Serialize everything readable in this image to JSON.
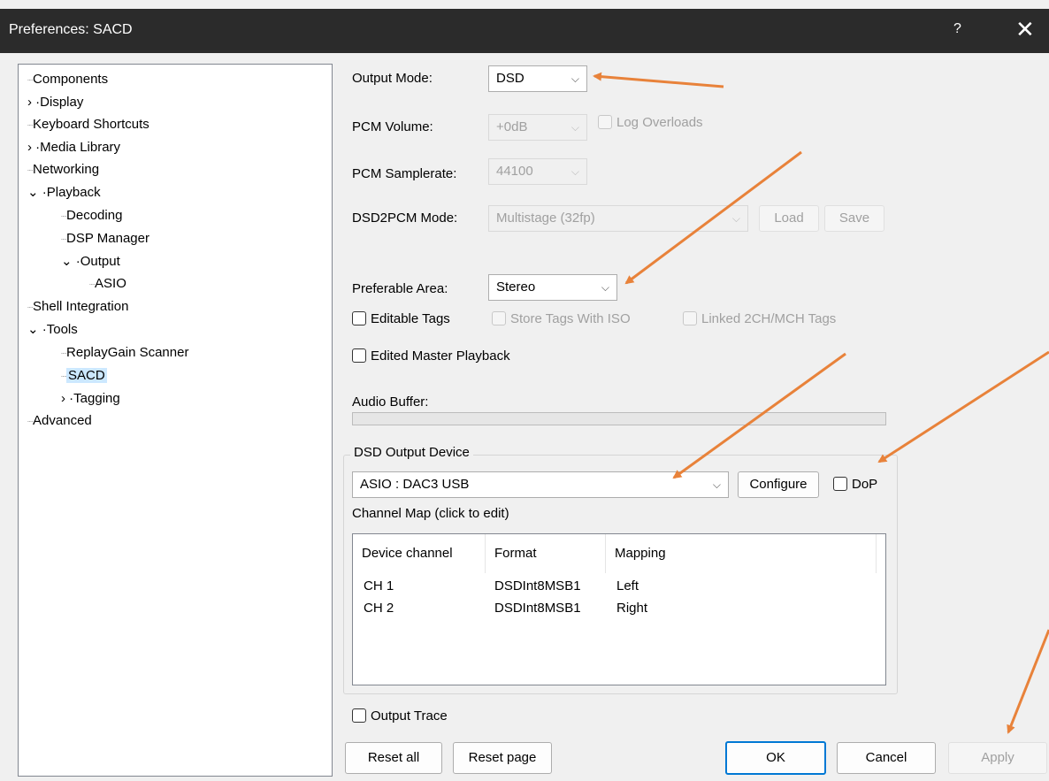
{
  "window": {
    "title": "Preferences: SACD",
    "help_glyph": "?",
    "close_glyph": "✕"
  },
  "tree": {
    "items": [
      {
        "label": "Components",
        "expander": ""
      },
      {
        "label": "Display",
        "expander": "›"
      },
      {
        "label": "Keyboard Shortcuts",
        "expander": ""
      },
      {
        "label": "Media Library",
        "expander": "›"
      },
      {
        "label": "Networking",
        "expander": ""
      },
      {
        "label": "Playback",
        "expander": "⌄"
      },
      {
        "label": "Decoding",
        "expander": ""
      },
      {
        "label": "DSP Manager",
        "expander": ""
      },
      {
        "label": "Output",
        "expander": "⌄"
      },
      {
        "label": "ASIO",
        "expander": ""
      },
      {
        "label": "Shell Integration",
        "expander": ""
      },
      {
        "label": "Tools",
        "expander": "⌄"
      },
      {
        "label": "ReplayGain Scanner",
        "expander": ""
      },
      {
        "label": "SACD",
        "expander": "",
        "selected": true
      },
      {
        "label": "Tagging",
        "expander": "›"
      },
      {
        "label": "Advanced",
        "expander": ""
      }
    ]
  },
  "settings": {
    "output_mode": {
      "label": "Output Mode:",
      "value": "DSD"
    },
    "pcm_volume": {
      "label": "PCM Volume:",
      "value": "+0dB",
      "log_overloads": "Log Overloads"
    },
    "pcm_samplerate": {
      "label": "PCM Samplerate:",
      "value": "44100"
    },
    "dsd2pcm_mode": {
      "label": "DSD2PCM Mode:",
      "value": "Multistage (32fp)",
      "load": "Load",
      "save": "Save"
    },
    "preferable_area": {
      "label": "Preferable Area:",
      "value": "Stereo"
    },
    "editable_tags": "Editable Tags",
    "store_tags_iso": "Store Tags With ISO",
    "linked_tags": "Linked 2CH/MCH Tags",
    "edited_master": "Edited Master Playback",
    "audio_buffer": {
      "label": "Audio Buffer:",
      "fill_fraction": 0.0
    }
  },
  "dsd_output": {
    "group_title": "DSD Output Device",
    "device": "ASIO : DAC3 USB",
    "configure": "Configure",
    "dop": "DoP",
    "channel_map_label": "Channel Map (click to edit)",
    "columns": [
      "Device channel",
      "Format",
      "Mapping"
    ],
    "rows": [
      [
        "CH 1",
        "DSDInt8MSB1",
        "Left"
      ],
      [
        "CH 2",
        "DSDInt8MSB1",
        "Right"
      ]
    ]
  },
  "output_trace": "Output Trace",
  "buttons": {
    "reset_all": "Reset all",
    "reset_page": "Reset page",
    "ok": "OK",
    "cancel": "Cancel",
    "apply": "Apply"
  },
  "annotation_color": "#e8823a",
  "chevron": "⌵"
}
